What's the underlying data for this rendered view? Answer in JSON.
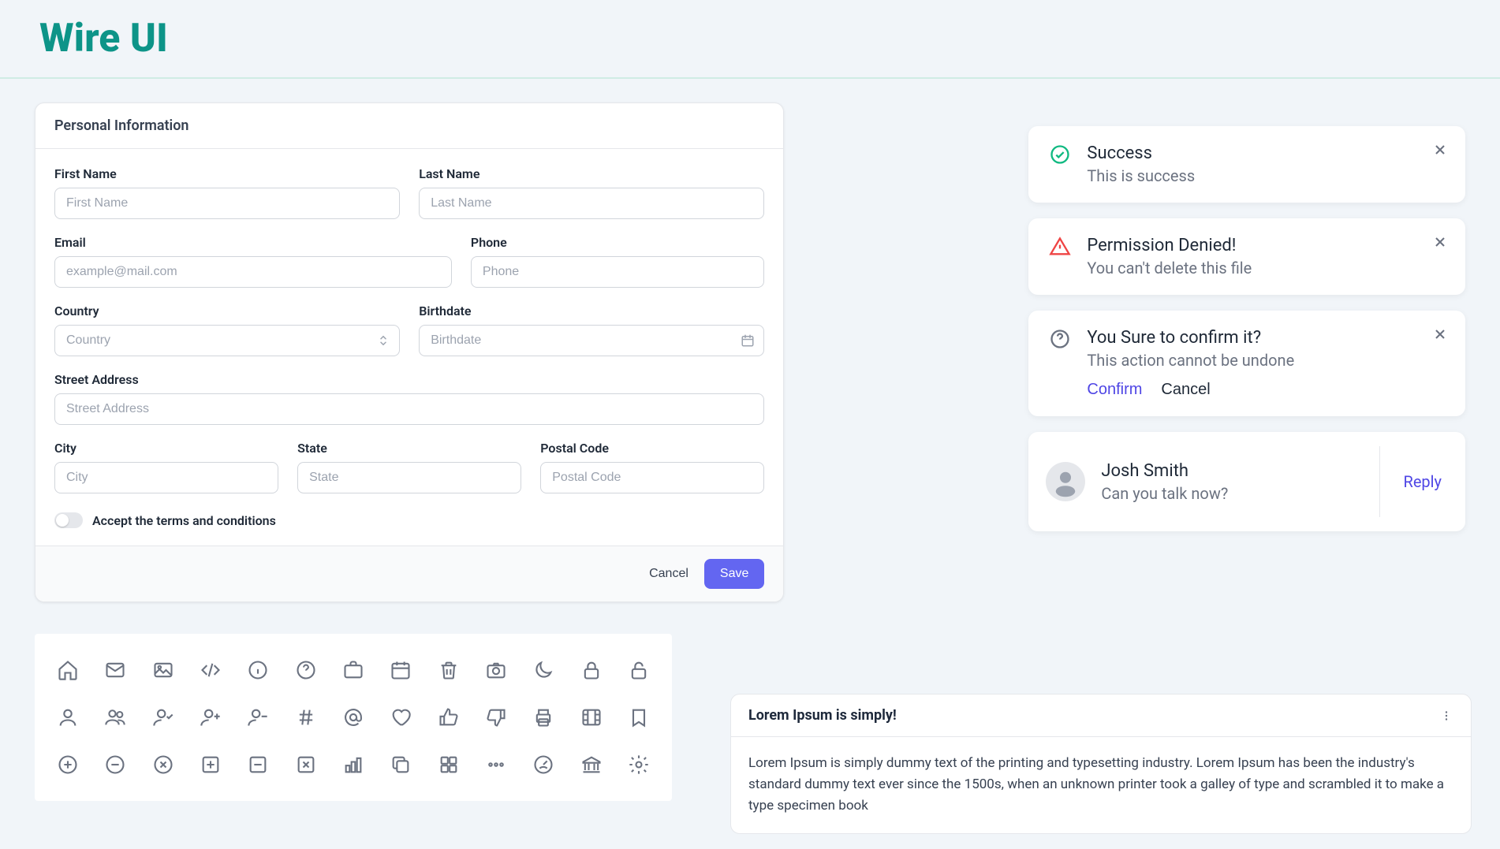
{
  "brand": "Wire UI",
  "form": {
    "title": "Personal Information",
    "first_name_label": "First Name",
    "first_name_placeholder": "First Name",
    "last_name_label": "Last Name",
    "last_name_placeholder": "Last Name",
    "email_label": "Email",
    "email_placeholder": "example@mail.com",
    "phone_label": "Phone",
    "phone_placeholder": "Phone",
    "country_label": "Country",
    "country_placeholder": "Country",
    "birthdate_label": "Birthdate",
    "birthdate_placeholder": "Birthdate",
    "street_label": "Street Address",
    "street_placeholder": "Street Address",
    "city_label": "City",
    "city_placeholder": "City",
    "state_label": "State",
    "state_placeholder": "State",
    "postal_label": "Postal Code",
    "postal_placeholder": "Postal Code",
    "terms_label": "Accept the terms and conditions",
    "cancel_label": "Cancel",
    "save_label": "Save"
  },
  "notifications": {
    "success": {
      "title": "Success",
      "desc": "This is success"
    },
    "denied": {
      "title": "Permission Denied!",
      "desc": "You can't delete this file"
    },
    "confirm": {
      "title": "You Sure to confirm it?",
      "desc": "This action cannot be undone",
      "confirm_label": "Confirm",
      "cancel_label": "Cancel"
    },
    "message": {
      "name": "Josh Smith",
      "text": "Can you talk now?",
      "reply_label": "Reply"
    }
  },
  "lorem": {
    "title": "Lorem Ipsum is simply!",
    "body": "Lorem Ipsum is simply dummy text of the printing and typesetting industry. Lorem Ipsum has been the industry's standard dummy text ever since the 1500s, when an unknown printer took a galley of type and scrambled it to make a type specimen book"
  },
  "colors": {
    "brand": "#0d9488",
    "primary": "#6366f1",
    "success": "#10b981",
    "error": "#ef4444",
    "muted": "#6b7280"
  }
}
